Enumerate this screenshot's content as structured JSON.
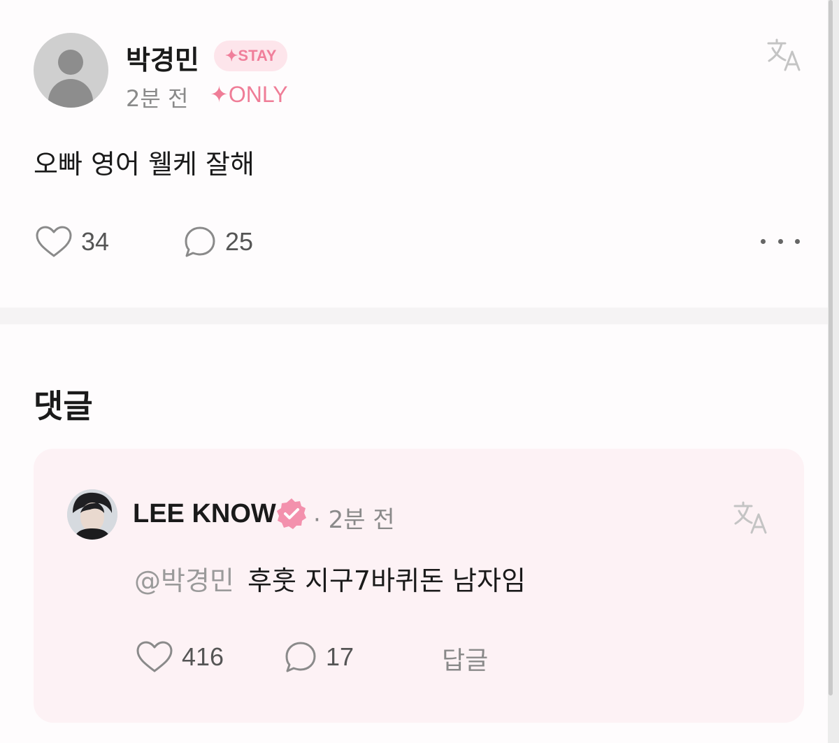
{
  "post": {
    "author": "박경민",
    "badge": "✦STAY",
    "time": "2분 전",
    "only_tag": "✦ONLY",
    "text": "오빠 영어 웰케 잘해",
    "likes": "34",
    "comments": "25"
  },
  "comments_section": {
    "title": "댓글",
    "items": [
      {
        "author": "LEE KNOW",
        "time": "· 2분 전",
        "mention": "@박경민",
        "text": "후훗 지구7바퀴돈 남자임",
        "likes": "416",
        "replies": "17",
        "reply_label": "답글"
      }
    ]
  },
  "colors": {
    "accent_pink": "#ef7d97",
    "badge_bg": "#fde5eb",
    "card_bg": "#fdf2f5"
  },
  "icons": [
    "avatar-icon",
    "translate-icon",
    "heart-icon",
    "comment-icon",
    "more-icon",
    "verified-badge-icon"
  ]
}
